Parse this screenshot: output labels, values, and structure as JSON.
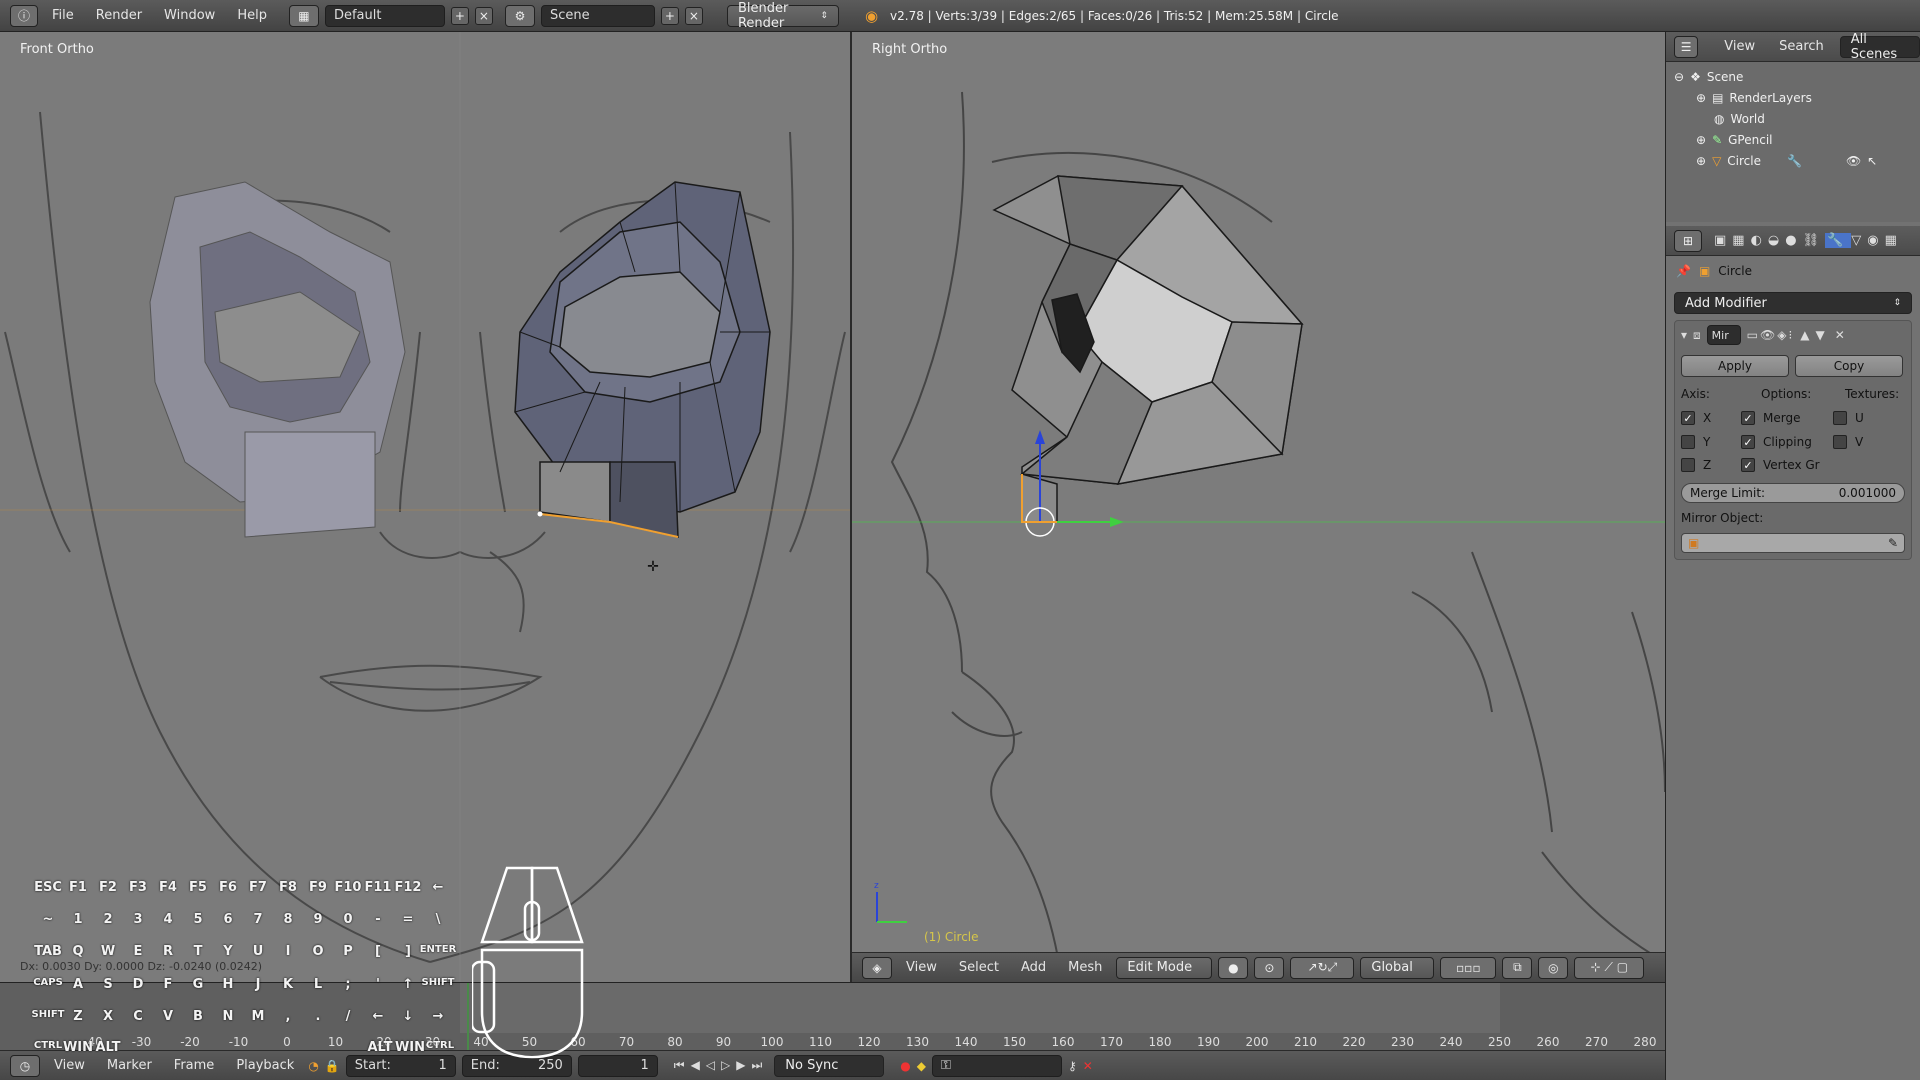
{
  "app": {
    "name": "Blender"
  },
  "topbar": {
    "menus": [
      "File",
      "Render",
      "Window",
      "Help"
    ],
    "layout": "Default",
    "scene": "Scene",
    "engine": "Blender Render",
    "stats": "v2.78 | Verts:3/39 | Edges:2/65 | Faces:0/26 | Tris:52 | Mem:25.58M | Circle"
  },
  "viewport_left": {
    "label": "Front Ortho"
  },
  "viewport_right": {
    "label": "Right Ortho",
    "object_label": "(1) Circle",
    "header": {
      "menus": [
        "View",
        "Select",
        "Add",
        "Mesh"
      ],
      "mode": "Edit Mode",
      "orientation": "Global"
    }
  },
  "outliner": {
    "header": {
      "view": "View",
      "search": "Search",
      "scenes": "All Scenes"
    },
    "items": [
      "Scene",
      "RenderLayers",
      "World",
      "GPencil",
      "Circle"
    ]
  },
  "properties": {
    "object_name": "Circle",
    "add_modifier": "Add Modifier",
    "modifier_name": "Mir",
    "apply": "Apply",
    "copy": "Copy",
    "axis_label": "Axis:",
    "options_label": "Options:",
    "textures_label": "Textures:",
    "axes": [
      {
        "name": "X",
        "checked": true
      },
      {
        "name": "Y",
        "checked": false
      },
      {
        "name": "Z",
        "checked": false
      }
    ],
    "options": [
      {
        "name": "Merge",
        "checked": true
      },
      {
        "name": "Clipping",
        "checked": true
      },
      {
        "name": "Vertex Gr",
        "checked": true
      }
    ],
    "textures": [
      {
        "name": "U",
        "checked": false
      },
      {
        "name": "V",
        "checked": false
      }
    ],
    "merge_limit_label": "Merge Limit:",
    "merge_limit_value": "0.001000",
    "mirror_object_label": "Mirror Object:"
  },
  "transform_readout": "Dx: 0.0030  Dy: 0.0000  Dz: -0.0240 (0.0242)",
  "timeline": {
    "ticks": [
      -40,
      -30,
      -20,
      -10,
      0,
      10,
      20,
      30,
      40,
      50,
      60,
      70,
      80,
      90,
      100,
      110,
      120,
      130,
      140,
      150,
      160,
      170,
      180,
      190,
      200,
      210,
      220,
      230,
      240,
      250,
      260,
      270,
      280
    ],
    "menus": [
      "View",
      "Marker",
      "Frame",
      "Playback"
    ],
    "start_label": "Start:",
    "start": "1",
    "end_label": "End:",
    "end": "250",
    "current": "1",
    "sync": "No Sync"
  },
  "keyboard_overlay": {
    "rows": [
      [
        "ESC",
        "F1",
        "F2",
        "F3",
        "F4",
        "F5",
        "F6",
        "F7",
        "F8",
        "F9",
        "F10",
        "F11",
        "F12",
        "←"
      ],
      [
        "~",
        "1",
        "2",
        "3",
        "4",
        "5",
        "6",
        "7",
        "8",
        "9",
        "0",
        "-",
        "=",
        "\\"
      ],
      [
        "TAB",
        "Q",
        "W",
        "E",
        "R",
        "T",
        "Y",
        "U",
        "I",
        "O",
        "P",
        "[",
        "]",
        "ENTER"
      ],
      [
        "CAPS",
        "A",
        "S",
        "D",
        "F",
        "G",
        "H",
        "J",
        "K",
        "L",
        ";",
        "'",
        "↑",
        "SHIFT"
      ],
      [
        "SHIFT",
        "Z",
        "X",
        "C",
        "V",
        "B",
        "N",
        "M",
        ",",
        ".",
        "/",
        "←",
        "↓",
        "→"
      ],
      [
        "CTRL",
        "WIN",
        "ALT",
        "ALT",
        "WIN",
        "CTRL"
      ]
    ]
  },
  "colors": {
    "accent_orange": "#f0a030",
    "axis_green": "#3fd040",
    "axis_blue": "#2a44d8",
    "panel_bg": "#727272"
  }
}
